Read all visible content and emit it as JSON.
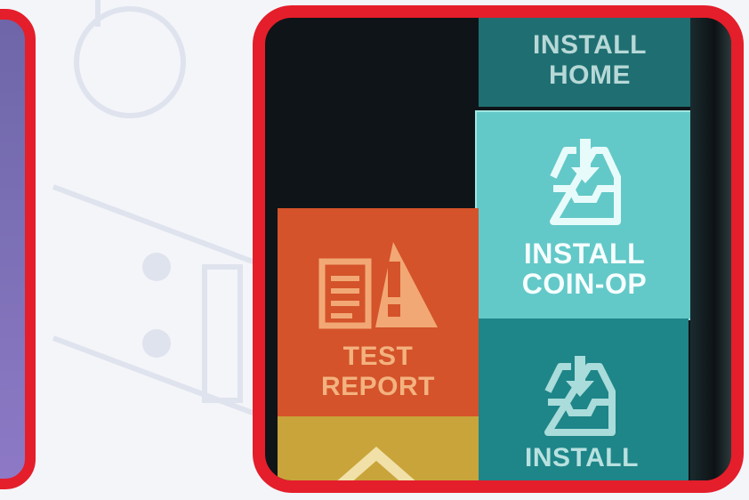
{
  "colors": {
    "frame": "#e41e2b",
    "background": "#f4f5f9"
  },
  "tiles": {
    "install_home": {
      "line1": "INSTALL",
      "line2": "HOME",
      "icon": "install-tray-icon"
    },
    "install_coinop": {
      "line1": "INSTALL",
      "line2": "COIN-OP",
      "icon": "install-tray-icon"
    },
    "install_ball": {
      "line1": "INSTALL",
      "line2": "",
      "icon": "install-tray-icon"
    },
    "test_report": {
      "line1": "TEST",
      "line2": "REPORT",
      "icon": "report-warning-icon"
    },
    "home_tile": {
      "icon": "house-icon"
    }
  }
}
